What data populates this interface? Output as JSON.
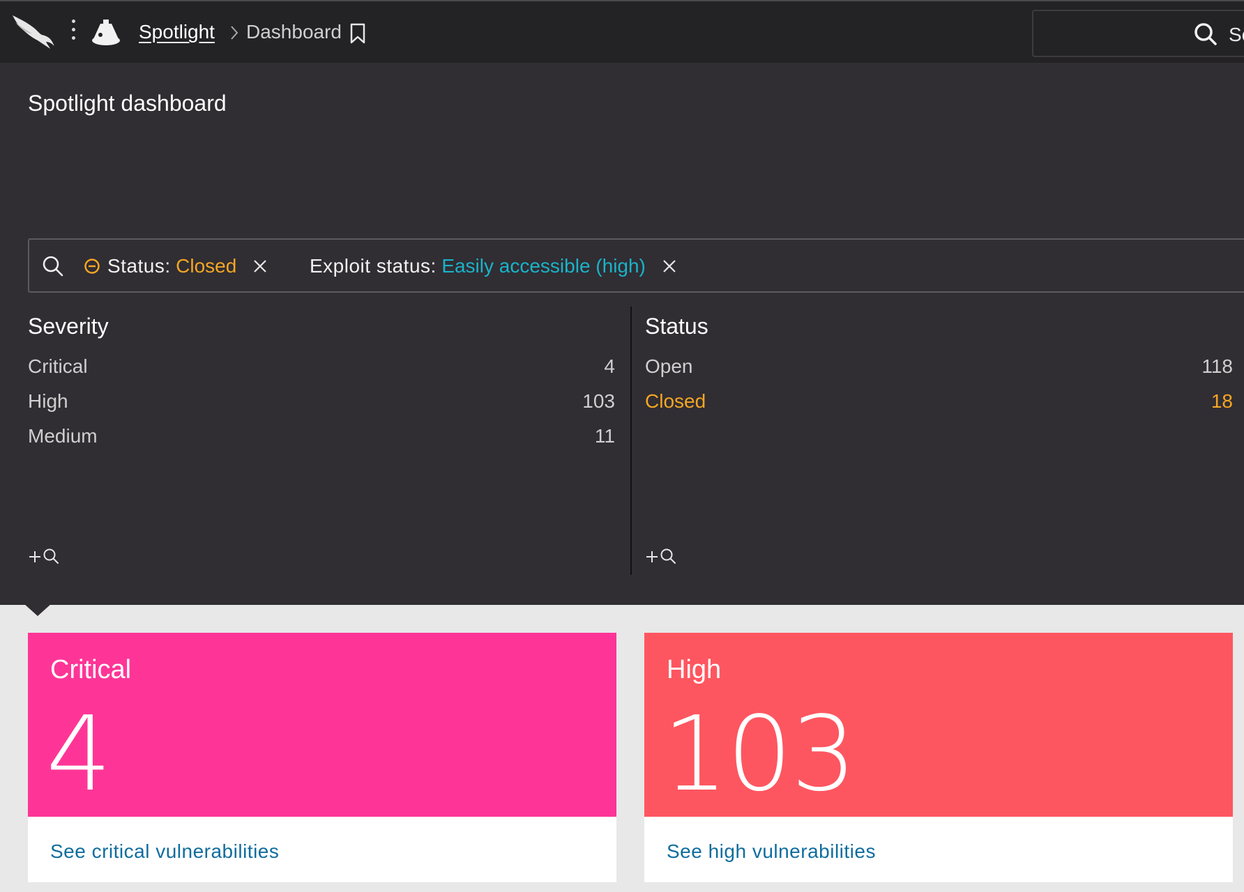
{
  "header": {
    "breadcrumb_app": "Spotlight",
    "breadcrumb_page": "Dashboard",
    "search_text": "Se"
  },
  "page": {
    "title": "Spotlight dashboard"
  },
  "filters": [
    {
      "key": "Status",
      "value": "Closed",
      "mode": "exclude",
      "value_color": "#f4a623"
    },
    {
      "key": "Exploit status",
      "value": "Easily accessible (high)",
      "value_color": "#1ab3c8"
    }
  ],
  "facets": {
    "severity": {
      "title": "Severity",
      "rows": [
        {
          "label": "Critical",
          "count": "4"
        },
        {
          "label": "High",
          "count": "103"
        },
        {
          "label": "Medium",
          "count": "11"
        }
      ]
    },
    "status": {
      "title": "Status",
      "rows": [
        {
          "label": "Open",
          "count": "118"
        },
        {
          "label": "Closed",
          "count": "18",
          "selected": true
        }
      ]
    }
  },
  "cards": {
    "critical": {
      "label": "Critical",
      "value": "4",
      "link": "See critical vulnerabilities",
      "color": "#fe3597"
    },
    "high": {
      "label": "High",
      "value": "103",
      "link": "See high vulnerabilities",
      "color": "#fe5660"
    }
  },
  "colors": {
    "accent_orange": "#f4a623",
    "accent_teal": "#1ab3c8",
    "link_blue": "#0f6d9e",
    "background": "#302d33",
    "topbar": "#232224"
  }
}
